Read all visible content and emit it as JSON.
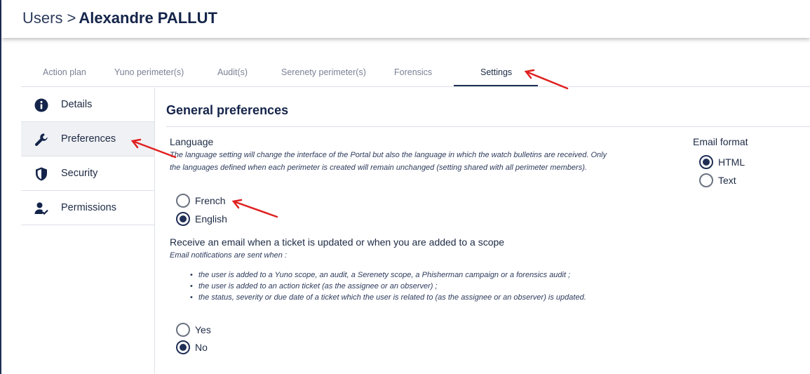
{
  "header": {
    "breadcrumb_root": "Users",
    "separator": ">",
    "user_name": "Alexandre PALLUT"
  },
  "tabs": [
    {
      "label": "Action plan",
      "active": false
    },
    {
      "label": "Yuno perimeter(s)",
      "active": false
    },
    {
      "label": "Audit(s)",
      "active": false
    },
    {
      "label": "Serenety perimeter(s)",
      "active": false
    },
    {
      "label": "Forensics",
      "active": false
    },
    {
      "label": "Settings",
      "active": true
    }
  ],
  "sidebar": {
    "items": [
      {
        "label": "Details",
        "icon": "info-icon",
        "active": false
      },
      {
        "label": "Preferences",
        "icon": "wrench-icon",
        "active": true
      },
      {
        "label": "Security",
        "icon": "shield-icon",
        "active": false
      },
      {
        "label": "Permissions",
        "icon": "user-check-icon",
        "active": false
      }
    ]
  },
  "preferences": {
    "title": "General preferences",
    "language": {
      "label": "Language",
      "description": "The language setting will change the interface of the Portal but also the language in which the watch bulletins are received. Only the languages defined when each perimeter is created will remain unchanged (setting shared with all perimeter members).",
      "options": [
        {
          "label": "French",
          "checked": false
        },
        {
          "label": "English",
          "checked": true
        }
      ]
    },
    "email_notifications": {
      "label": "Receive an email when a ticket is updated or when you are added to a scope",
      "description": "Email notifications are sent when :",
      "bullets": [
        "the user is added to a Yuno scope, an audit, a Serenety scope, a Phisherman campaign or a forensics audit ;",
        "the user is added to an action ticket (as the assignee or an observer) ;",
        "the status, severity or due date of a ticket which the user is related to (as the assignee or an observer) is updated."
      ],
      "options": [
        {
          "label": "Yes",
          "checked": false
        },
        {
          "label": "No",
          "checked": true
        }
      ]
    },
    "email_format": {
      "label": "Email format",
      "options": [
        {
          "label": "HTML",
          "checked": true
        },
        {
          "label": "Text",
          "checked": false
        }
      ]
    }
  },
  "colors": {
    "primary": "#1f2f56",
    "annotation_arrow": "#e02020",
    "active_sidebar_bg": "#f0f1f4"
  }
}
